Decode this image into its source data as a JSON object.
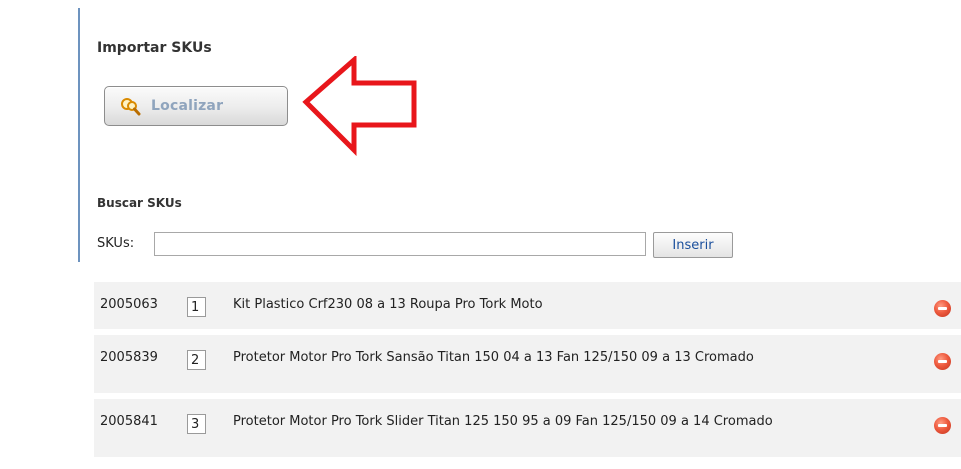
{
  "import_section": {
    "title": "Importar SKUs",
    "locate_button_label": "Localizar",
    "locate_icon": "search-magnifier-icon"
  },
  "annotation": {
    "arrow_color": "#e8161b",
    "arrow_icon": "red-arrow-left-icon"
  },
  "search_section": {
    "title": "Buscar SKUs",
    "skus_label": "SKUs:",
    "skus_input_value": "",
    "insert_button_label": "Inserir"
  },
  "sku_list": [
    {
      "sku": "2005063",
      "quantity": "1",
      "description": "Kit Plastico Crf230 08 a 13 Roupa Pro Tork Moto",
      "remove_icon": "remove-minus-icon"
    },
    {
      "sku": "2005839",
      "quantity": "2",
      "description": "Protetor Motor Pro Tork Sansão Titan 150 04 a 13 Fan 125/150 09 a 13 Cromado",
      "remove_icon": "remove-minus-icon"
    },
    {
      "sku": "2005841",
      "quantity": "3",
      "description": "Protetor Motor Pro Tork Slider Titan 125 150 95 a 09 Fan 125/150 09 a 14 Cromado",
      "remove_icon": "remove-minus-icon"
    }
  ]
}
